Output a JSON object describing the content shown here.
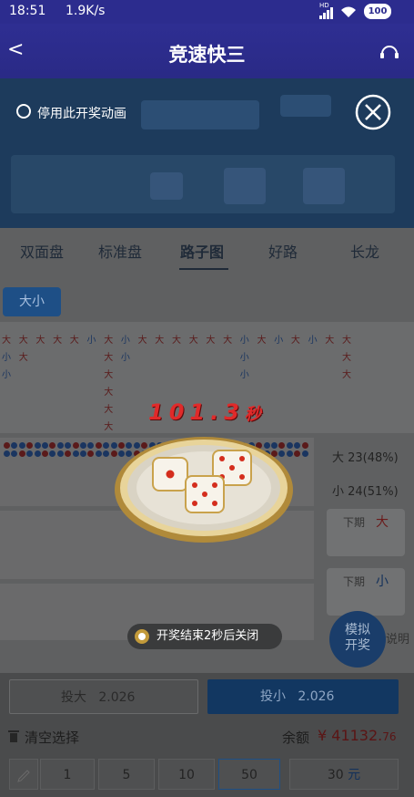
{
  "status": {
    "time": "18:51",
    "speed": "1.9K/s",
    "hd": "HD",
    "battery": "100"
  },
  "nav": {
    "back": "<",
    "title": "竞速快三"
  },
  "anim_toggle_label": "停用此开奖动画",
  "tabs": [
    "双面盘",
    "标准盘",
    "路子图",
    "好路",
    "长龙"
  ],
  "road_filter": "大小",
  "timer": "101.3",
  "timer_unit": "秒",
  "stats": {
    "big": "大 23(48%)",
    "small": "小 24(51%)"
  },
  "next_big": {
    "label": "下期",
    "value": "大"
  },
  "next_small": {
    "label": "下期",
    "value": "小"
  },
  "sim_button": "模拟\n开奖",
  "sim_side": "说明",
  "close_notice": "开奖结束2秒后关闭",
  "bet_big": {
    "label": "投大",
    "amount": "2.026"
  },
  "bet_small": {
    "label": "投小",
    "amount": "2.026"
  },
  "clear_label": "清空选择",
  "balance_label": "余额",
  "balance_value": "¥ 41132.",
  "balance_decimal": "76",
  "chips": [
    "1",
    "5",
    "10",
    "50"
  ],
  "custom_amount": "30",
  "custom_unit": "元",
  "colors": {
    "nav": "#2c2c8e",
    "accent_blue": "#1e63b5",
    "red": "#c0302b"
  }
}
